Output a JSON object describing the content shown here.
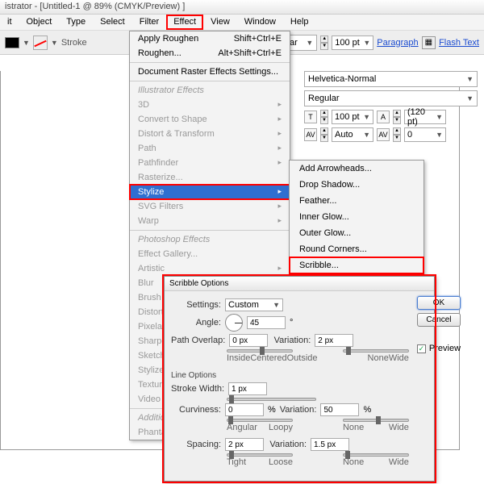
{
  "title": "istrator - [Untitled-1 @ 89% (CMYK/Preview) ]",
  "menubar": [
    "it",
    "Object",
    "Type",
    "Select",
    "Filter",
    "Effect",
    "View",
    "Window",
    "Help"
  ],
  "menubar_hl_index": 5,
  "toolbar": {
    "stroke_label": "Stroke",
    "pt_value": "100 pt",
    "paragraph": "Paragraph",
    "flash": "Flash Text",
    "combo": "egular"
  },
  "charpanel": {
    "font": "Helvetica-Normal",
    "style": "Regular",
    "size": "100 pt",
    "leading": "(120 pt)",
    "kerning": "Auto",
    "tracking": "0"
  },
  "effect_menu": {
    "top": [
      {
        "label": "Apply Roughen",
        "kb": "Shift+Ctrl+E"
      },
      {
        "label": "Roughen...",
        "kb": "Alt+Shift+Ctrl+E"
      }
    ],
    "settings": "Document Raster Effects Settings...",
    "head1": "Illustrator Effects",
    "ill": [
      "3D",
      "Convert to Shape",
      "Distort & Transform",
      "Path",
      "Pathfinder",
      "Rasterize...",
      "Stylize",
      "SVG Filters",
      "Warp"
    ],
    "ill_sel_index": 6,
    "head2": "Photoshop Effects",
    "ps": [
      "Effect Gallery...",
      "Artistic",
      "Blur",
      "Brush Strokes",
      "Distort",
      "Pixelate",
      "Sharpen",
      "Sketch",
      "Stylize",
      "Texture",
      "Video"
    ],
    "head3": "Additiona",
    "addl": [
      "Phantas"
    ]
  },
  "submenu": [
    "Add Arrowheads...",
    "Drop Shadow...",
    "Feather...",
    "Inner Glow...",
    "Outer Glow...",
    "Round Corners...",
    "Scribble..."
  ],
  "submenu_hl_index": 6,
  "dialog": {
    "title": "Scribble Options",
    "settings_label": "Settings:",
    "settings_value": "Custom",
    "angle_label": "Angle:",
    "angle_value": "45",
    "angle_unit": "°",
    "pathoverlap_label": "Path Overlap:",
    "pathoverlap_value": "0 px",
    "variation_label": "Variation:",
    "po_variation": "2 px",
    "po_ticks": [
      "Inside",
      "Centered",
      "Outside"
    ],
    "var_ticks": [
      "None",
      "Wide"
    ],
    "line_options": "Line Options",
    "strokewidth_label": "Stroke Width:",
    "strokewidth_value": "1 px",
    "curviness_label": "Curviness:",
    "curviness_value": "0",
    "pct": "%",
    "curv_variation": "50",
    "curv_ticks": [
      "Angular",
      "Loopy"
    ],
    "spacing_label": "Spacing:",
    "spacing_value": "2 px",
    "sp_variation": "1.5 px",
    "sp_ticks": [
      "Tight",
      "Loose"
    ],
    "ok": "OK",
    "cancel": "Cancel",
    "preview": "Preview"
  }
}
